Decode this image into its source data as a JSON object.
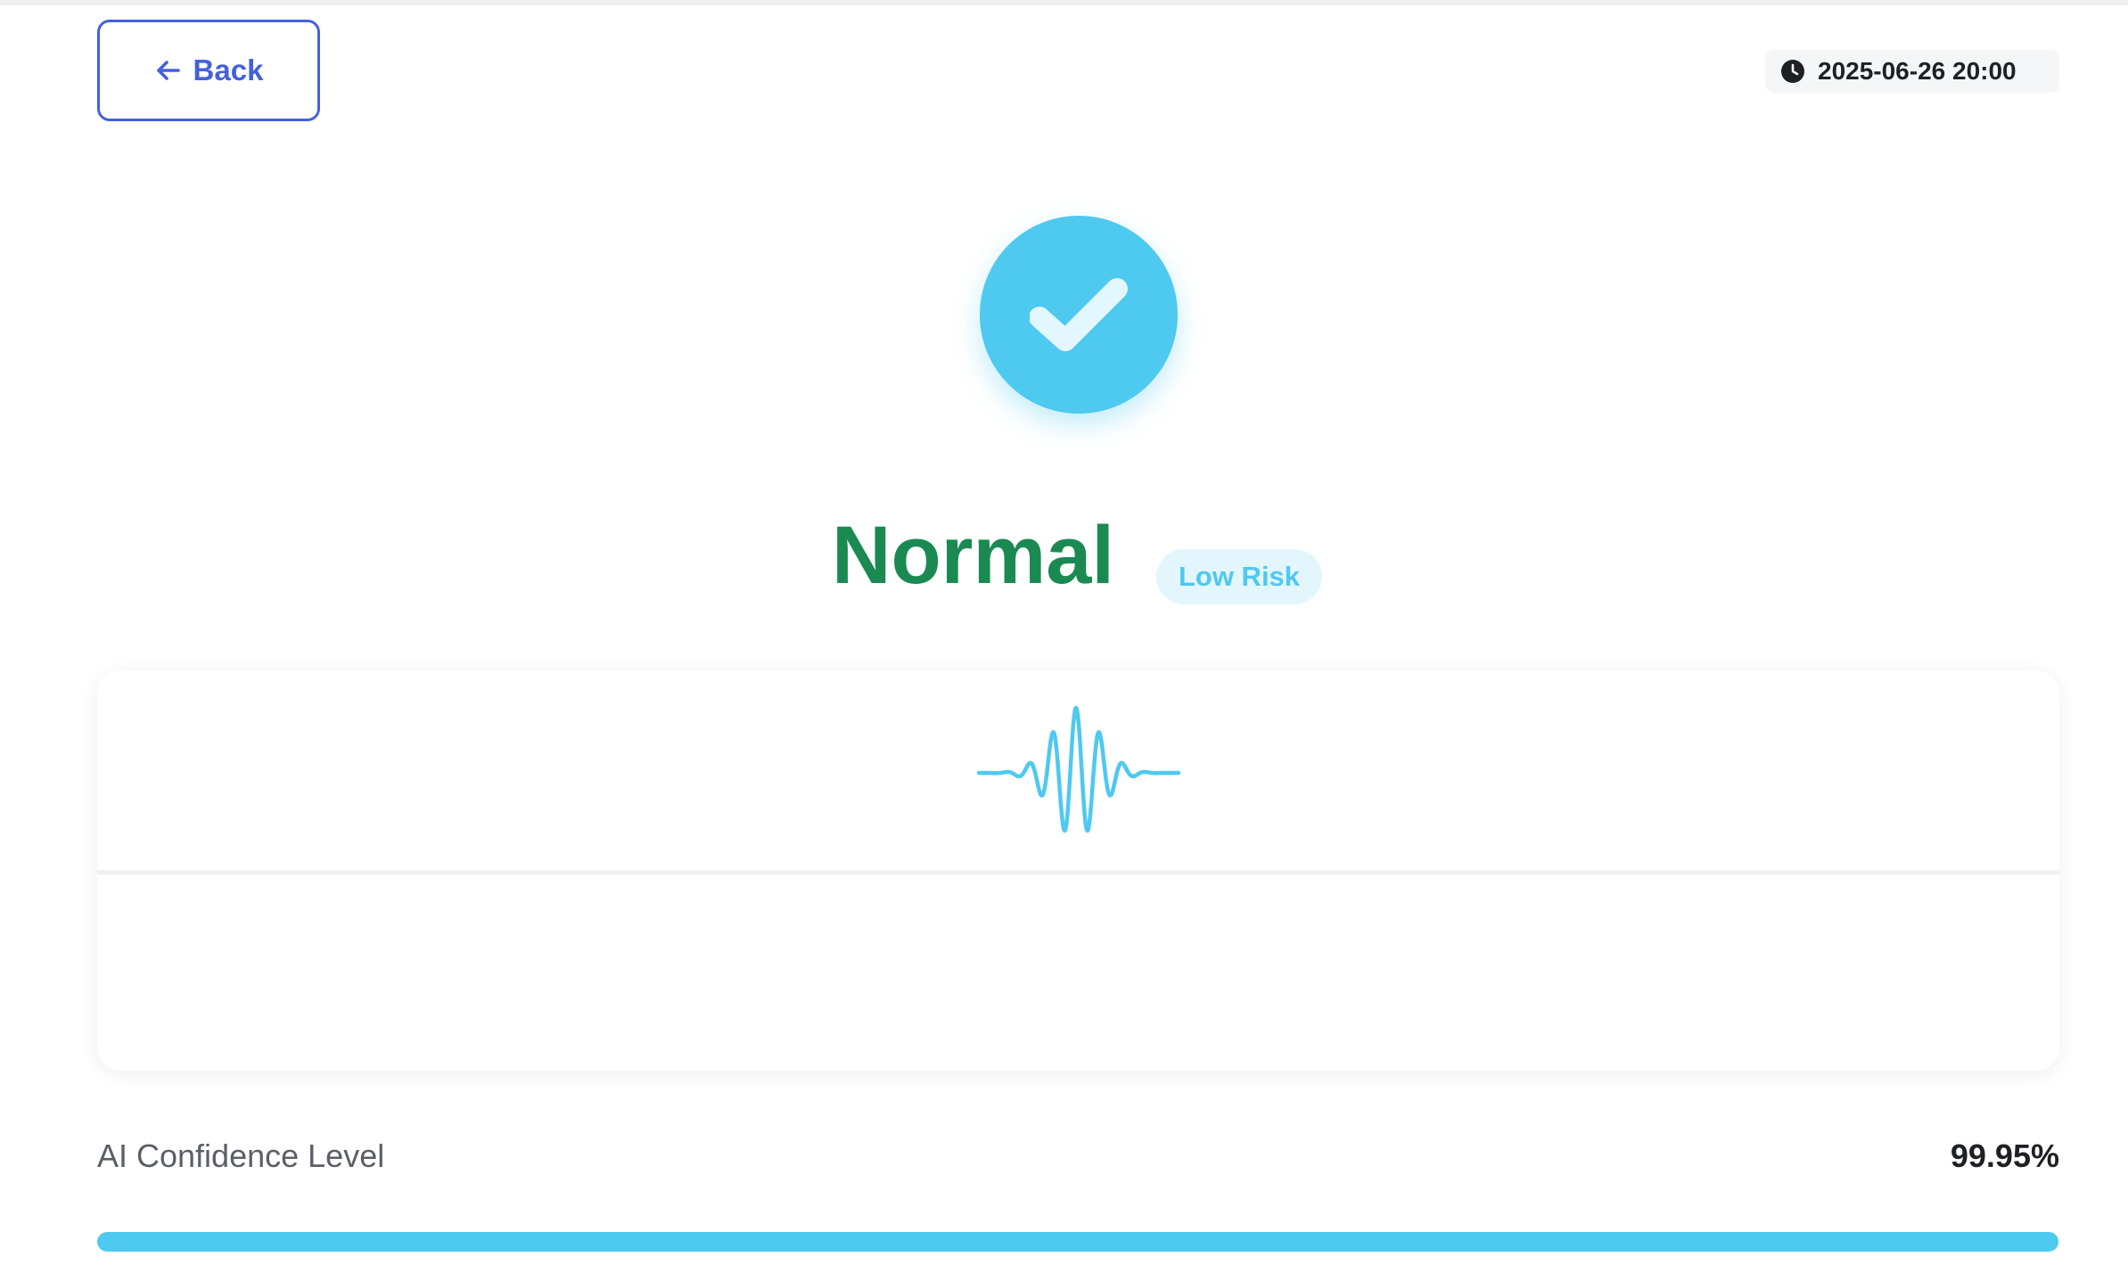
{
  "header": {
    "back_label": "Back",
    "back_icon": "arrow-left-icon",
    "timestamp": "2025-06-26 20:00",
    "timestamp_icon": "clock-icon"
  },
  "result": {
    "status_icon": "check-icon",
    "status": "Normal",
    "risk_badge": "Low Risk",
    "waveform_icon": "waveform-icon"
  },
  "confidence": {
    "label": "AI Confidence Level",
    "value_text": "99.95%",
    "fraction": 0.9995
  },
  "colors": {
    "accent": "#4ec9f0",
    "primary": "#4461dc",
    "status_text": "#1a8a52",
    "badge_background": "#e3f6fd"
  }
}
